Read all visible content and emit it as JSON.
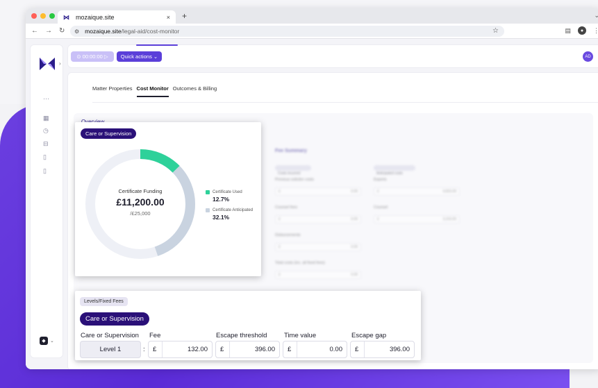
{
  "browser": {
    "tab_title": "mozaique.site",
    "tab_close": "×",
    "new_tab": "+",
    "url_host": "mozaique.site",
    "url_path": "/legal-aid/cost-monitor",
    "dot_colors": [
      "#ff5f57",
      "#febc2e",
      "#28c840"
    ]
  },
  "topbar": {
    "timer_label": "⊙ 00:00:00 ▷",
    "quick_actions_label": "Quick actions ⌄",
    "avatar_initials": "AD"
  },
  "tabs": [
    {
      "label": "Matter Properties"
    },
    {
      "label": "Cost Monitor",
      "active": true
    },
    {
      "label": "Outcomes & Billing"
    }
  ],
  "overview": {
    "title": "Overview"
  },
  "funding_card": {
    "category_label": "Care or Supervision",
    "center_label": "Certificate Funding",
    "amount": "£11,200.00",
    "limit": "/£25,000",
    "used_fraction": 0.127,
    "anticipated_fraction": 0.321,
    "legend": [
      {
        "label": "Certificate Used",
        "value": "12.7%",
        "color": "#2ed19a"
      },
      {
        "label": "Certificate Anticipated",
        "value": "32.1%",
        "color": "#c9d3e0"
      }
    ],
    "track_color": "#eef0f6"
  },
  "fee_summary": {
    "title": "Fee Summary",
    "chips": [
      "Costs incurred",
      "Anticipated costs"
    ],
    "labels": [
      "Previous solicitor costs",
      "Experts",
      "Counsel fees",
      "Counsel",
      "Disbursements",
      "Total costs (inc. all fixed fees)"
    ],
    "values": [
      "£",
      "0.00",
      "£",
      "4,815.00",
      "£",
      "0.00",
      "£",
      "3,210.00",
      "£",
      "0.00",
      "£",
      "0.00"
    ]
  },
  "levels_card": {
    "header_label": "Levels/Fixed Fees",
    "category_label": "Care or Supervision",
    "columns": [
      "Care or Supervision",
      "Fee",
      "Escape threshold",
      "Time value",
      "Escape gap"
    ],
    "level": "Level 1",
    "separator": ":",
    "currency": "£",
    "fee": "132.00",
    "escape_threshold": "396.00",
    "time_value": "0.00",
    "escape_gap": "396.00"
  }
}
